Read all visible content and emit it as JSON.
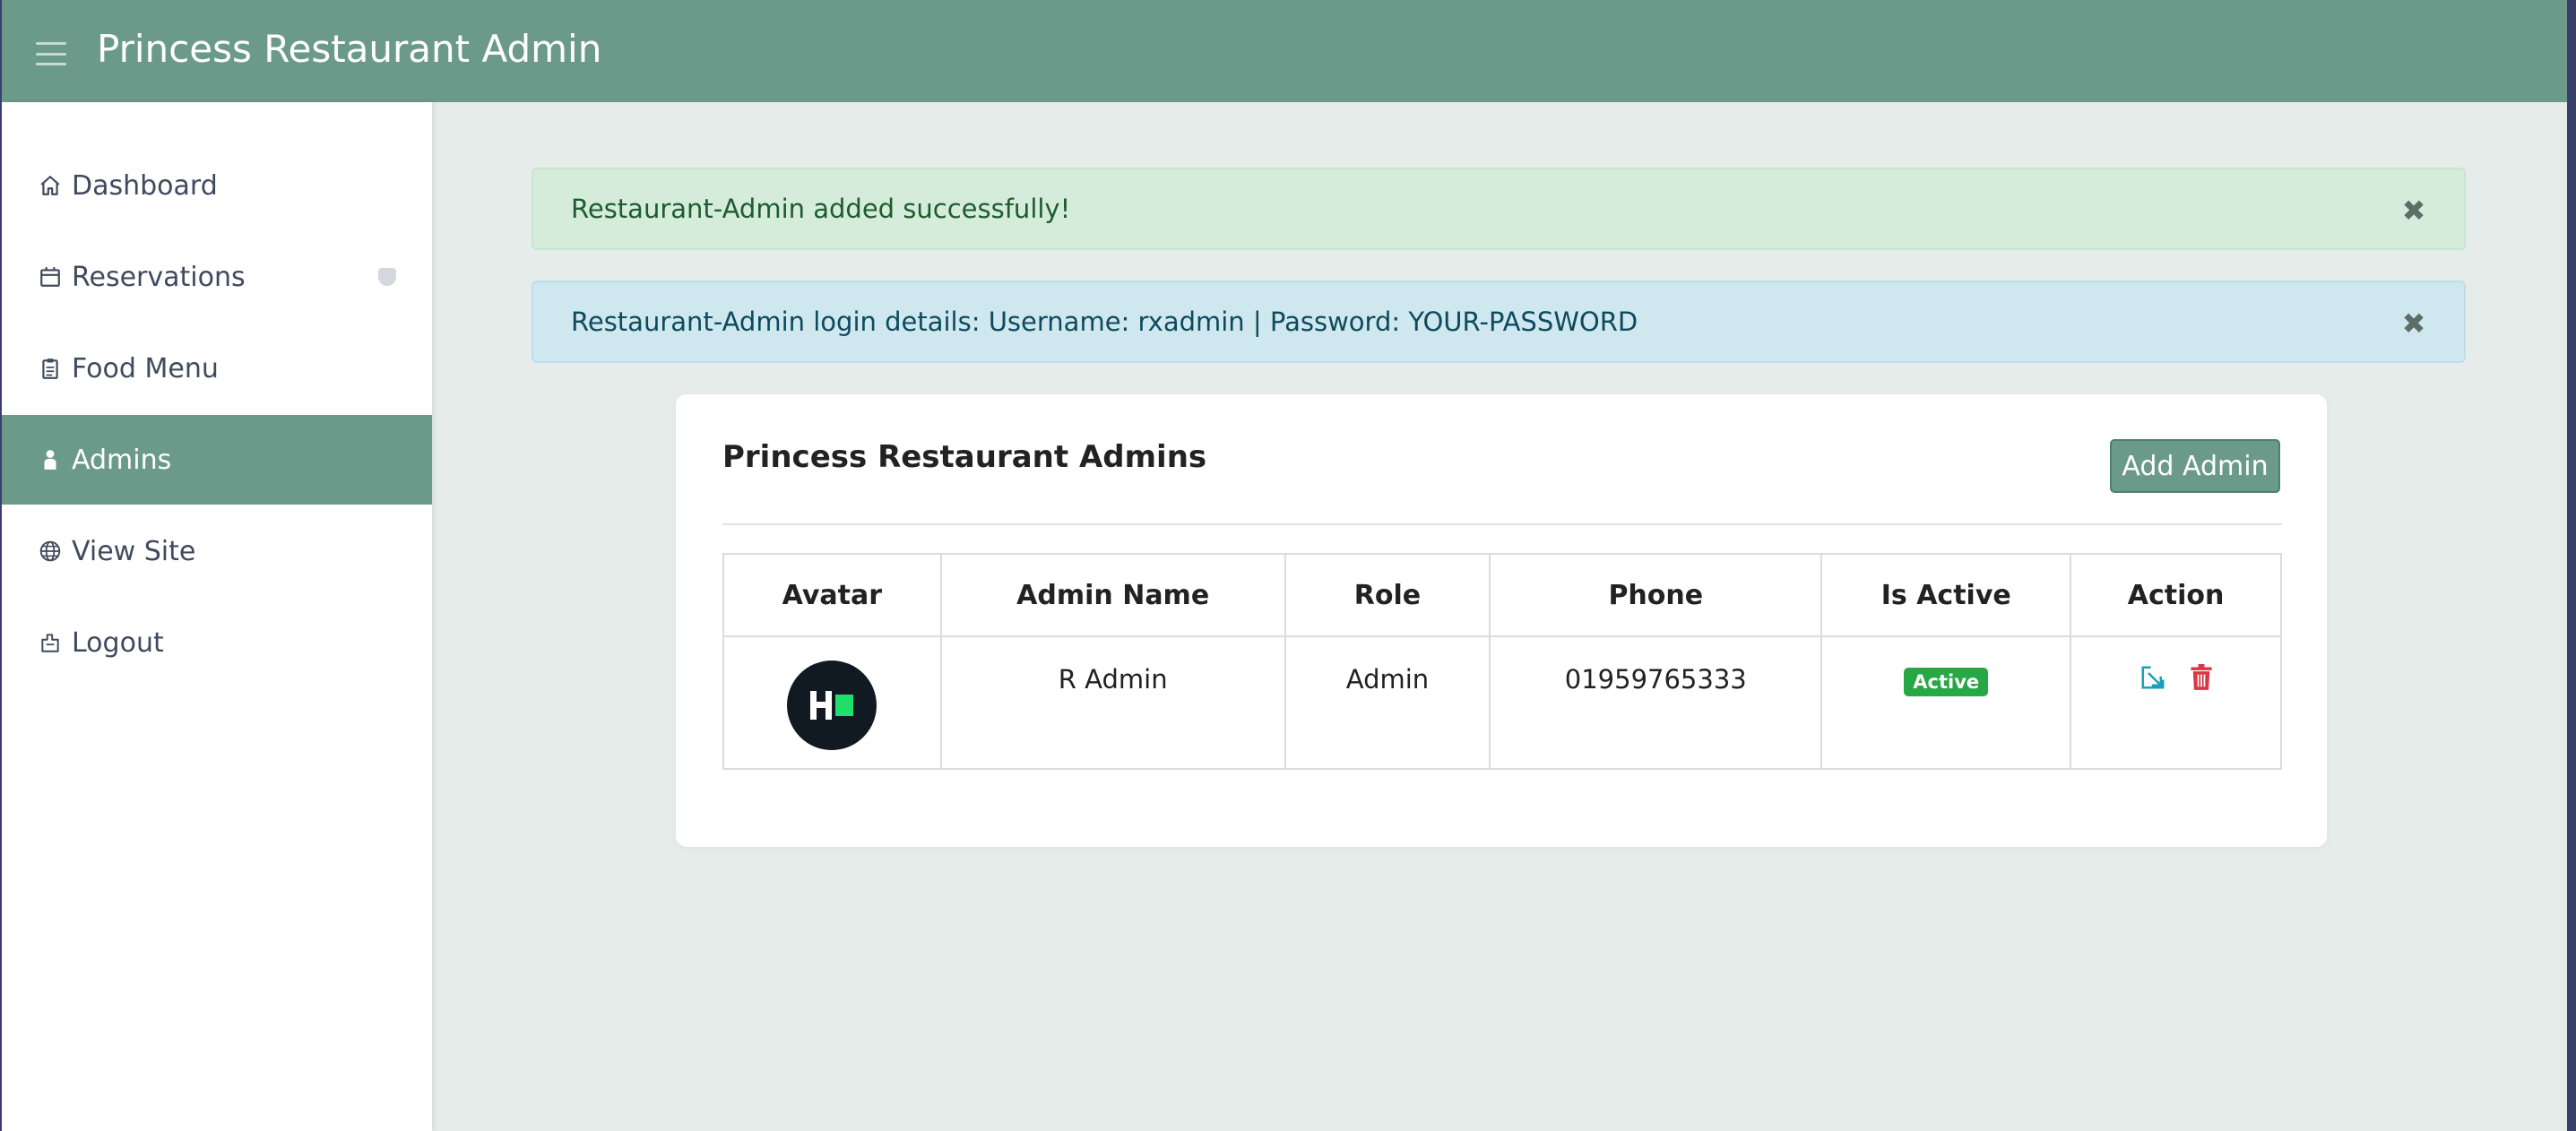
{
  "header": {
    "title": "Princess Restaurant Admin",
    "menu_icon": "hamburger-icon"
  },
  "sidebar": {
    "items": [
      {
        "label": "Dashboard",
        "icon": "home-icon"
      },
      {
        "label": "Reservations",
        "icon": "calendar-icon"
      },
      {
        "label": "Food Menu",
        "icon": "clipboard-icon"
      },
      {
        "label": "Admins",
        "icon": "user-icon",
        "active": true
      },
      {
        "label": "View Site",
        "icon": "globe-icon"
      },
      {
        "label": "Logout",
        "icon": "logout-icon"
      }
    ]
  },
  "alerts": {
    "success": "Restaurant-Admin added successfully!",
    "info": "Restaurant-Admin login details: Username: rxadmin | Password: YOUR-PASSWORD"
  },
  "card": {
    "title": "Princess Restaurant Admins",
    "add_button": "Add Admin",
    "columns": [
      "Avatar",
      "Admin Name",
      "Role",
      "Phone",
      "Is Active",
      "Action"
    ],
    "rows": [
      {
        "admin_name": "R Admin",
        "role": "Admin",
        "phone": "01959765333",
        "status": "Active"
      }
    ]
  },
  "colors": {
    "primary": "#6b9a8b",
    "success": "#28a745",
    "danger": "#dc3545",
    "info": "#17a2b8"
  }
}
